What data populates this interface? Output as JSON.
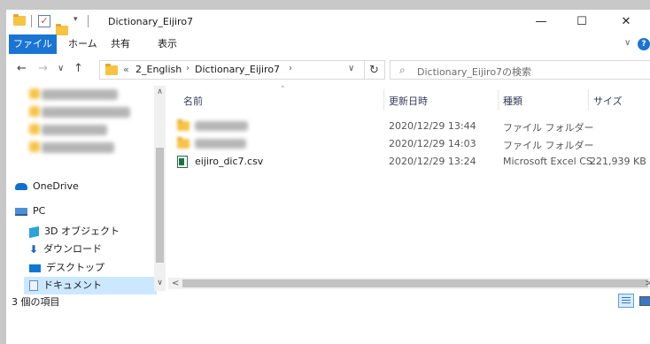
{
  "window": {
    "title": "Dictionary_Eijiro7"
  },
  "title_controls": {
    "minimize": "—",
    "maximize": "☐",
    "close": "✕"
  },
  "ribbon": {
    "tabs": [
      "ファイル",
      "ホーム",
      "共有",
      "表示"
    ],
    "expand": "∨",
    "help": "?"
  },
  "nav_buttons": {
    "back": "←",
    "forward": "→",
    "recent": "∨",
    "up": "↑"
  },
  "breadcrumb": {
    "overflow": "«",
    "items": [
      "2_English",
      "Dictionary_Eijiro7"
    ],
    "separator": "›",
    "dropdown": "∨"
  },
  "refresh_icon": "↻",
  "search": {
    "icon": "⌕",
    "placeholder": "Dictionary_Eijiro7の検索"
  },
  "nav_pane": {
    "items": [
      {
        "label": "OneDrive",
        "icon": "cloud-icon"
      },
      {
        "label": "PC",
        "icon": "computer-icon"
      },
      {
        "label": "3D オブジェクト",
        "icon": "3d-objects-icon"
      },
      {
        "label": "ダウンロード",
        "icon": "download-icon"
      },
      {
        "label": "デスクトップ",
        "icon": "desktop-icon"
      },
      {
        "label": "ドキュメント",
        "icon": "documents-icon"
      }
    ],
    "scroll_up": "∧",
    "scroll_down": "∨"
  },
  "file_list": {
    "columns": {
      "name": "名前",
      "date": "更新日時",
      "type": "種類",
      "size": "サイズ"
    },
    "sort_indicator": "˄",
    "rows": [
      {
        "name": "",
        "date": "2020/12/29 13:44",
        "type": "ファイル フォルダー",
        "size": "",
        "icon": "folder-icon"
      },
      {
        "name": "",
        "date": "2020/12/29 14:03",
        "type": "ファイル フォルダー",
        "size": "",
        "icon": "folder-icon"
      },
      {
        "name": "eijiro_dic7.csv",
        "date": "2020/12/29 13:24",
        "type": "Microsoft Excel CS...",
        "size": "221,939 KB",
        "icon": "excel-csv-icon"
      }
    ],
    "hscroll_left": "<",
    "hscroll_right": ">"
  },
  "status": {
    "item_count": "3 個の項目"
  },
  "colors": {
    "accent": "#1a74d4",
    "folder": "#f6c344",
    "selection": "#cce8ff"
  }
}
